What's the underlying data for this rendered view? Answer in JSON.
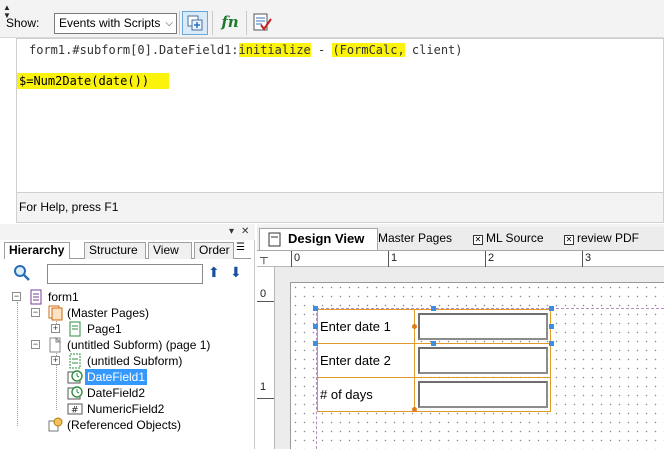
{
  "toolbar": {
    "show_label": "Show:",
    "show_value": "Events with Scripts",
    "fn_label": "fn"
  },
  "editor": {
    "header_prefix": "form1.#subform[0].DateField1:",
    "header_event": "initialize",
    "header_dash": " - ",
    "header_lang": "(FormCalc,",
    "header_run": " client)",
    "code": "$=Num2Date(date())",
    "highlight_color": "#fbf30c"
  },
  "help": {
    "text": "For Help, press F1"
  },
  "hierarchy": {
    "tabs": [
      "Hierarchy",
      "Structure",
      "View",
      "Order"
    ],
    "search_value": "",
    "tree": [
      {
        "label": "form1",
        "icon": "form-icon"
      },
      {
        "label": "(Master Pages)",
        "icon": "master-pages-icon"
      },
      {
        "label": "Page1",
        "icon": "page-icon"
      },
      {
        "label": "(untitled Subform) (page 1)",
        "icon": "subform-page-icon"
      },
      {
        "label": "(untitled Subform)",
        "icon": "subform-icon"
      },
      {
        "label": "DateField1",
        "icon": "date-field-icon",
        "selected": true
      },
      {
        "label": "DateField2",
        "icon": "date-field-icon"
      },
      {
        "label": "NumericField2",
        "icon": "numeric-field-icon"
      },
      {
        "label": "(Referenced Objects)",
        "icon": "referenced-objects-icon"
      }
    ]
  },
  "design": {
    "tabs": [
      "Design View",
      "Master Pages",
      "ML Source",
      "review PDF"
    ],
    "ruler_h": [
      "0",
      "1",
      "2",
      "3"
    ],
    "ruler_v": [
      "0",
      "1"
    ],
    "fields": [
      {
        "caption": "Enter date 1"
      },
      {
        "caption": "Enter date 2"
      },
      {
        "caption": "# of days"
      }
    ]
  }
}
